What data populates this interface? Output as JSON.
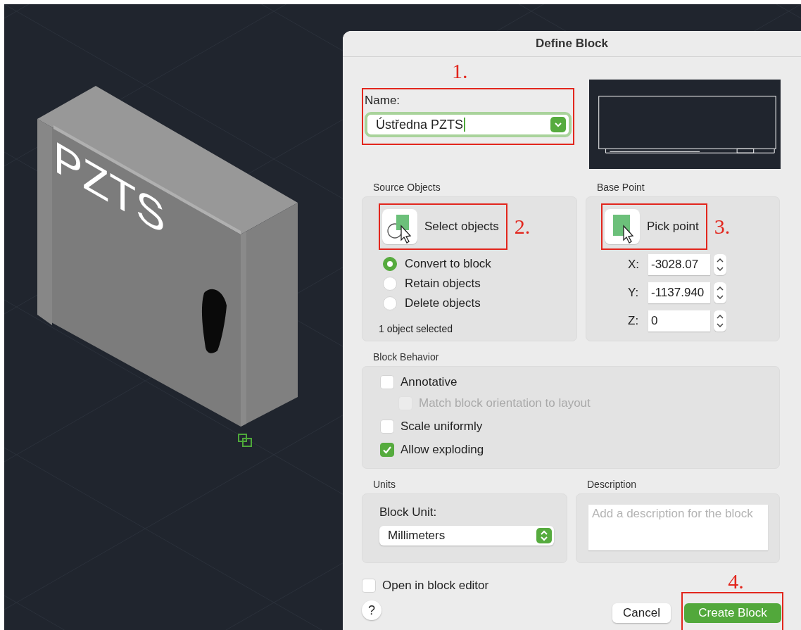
{
  "window": {
    "title": "Define Block"
  },
  "model": {
    "label": "PZTS"
  },
  "steps": [
    "1.",
    "2.",
    "3.",
    "4."
  ],
  "name": {
    "label": "Name:",
    "value": "Ústředna PZTS"
  },
  "source_objects": {
    "title": "Source Objects",
    "button": "Select objects",
    "status": "1 object selected",
    "options": [
      {
        "label": "Convert to block",
        "selected": true
      },
      {
        "label": "Retain objects",
        "selected": false
      },
      {
        "label": "Delete objects",
        "selected": false
      }
    ]
  },
  "base_point": {
    "title": "Base Point",
    "button": "Pick point",
    "coords": [
      {
        "axis": "X:",
        "value": "-3028.07"
      },
      {
        "axis": "Y:",
        "value": "-1137.940"
      },
      {
        "axis": "Z:",
        "value": "0"
      }
    ]
  },
  "block_behavior": {
    "title": "Block Behavior",
    "options": [
      {
        "label": "Annotative",
        "checked": false,
        "disabled": false,
        "children": [
          {
            "label": "Match block orientation to layout",
            "checked": false,
            "disabled": true
          }
        ]
      },
      {
        "label": "Scale uniformly",
        "checked": false,
        "disabled": false
      },
      {
        "label": "Allow exploding",
        "checked": true,
        "disabled": false
      }
    ]
  },
  "units": {
    "title": "Units",
    "label": "Block Unit:",
    "value": "Millimeters"
  },
  "description": {
    "title": "Description",
    "placeholder": "Add a description for the block"
  },
  "open_in_editor": {
    "label": "Open in block editor",
    "checked": false
  },
  "buttons": [
    {
      "kind": "help",
      "label": "?"
    },
    {
      "kind": "cancel",
      "label": "Cancel"
    },
    {
      "kind": "primary",
      "label": "Create Block"
    }
  ]
}
